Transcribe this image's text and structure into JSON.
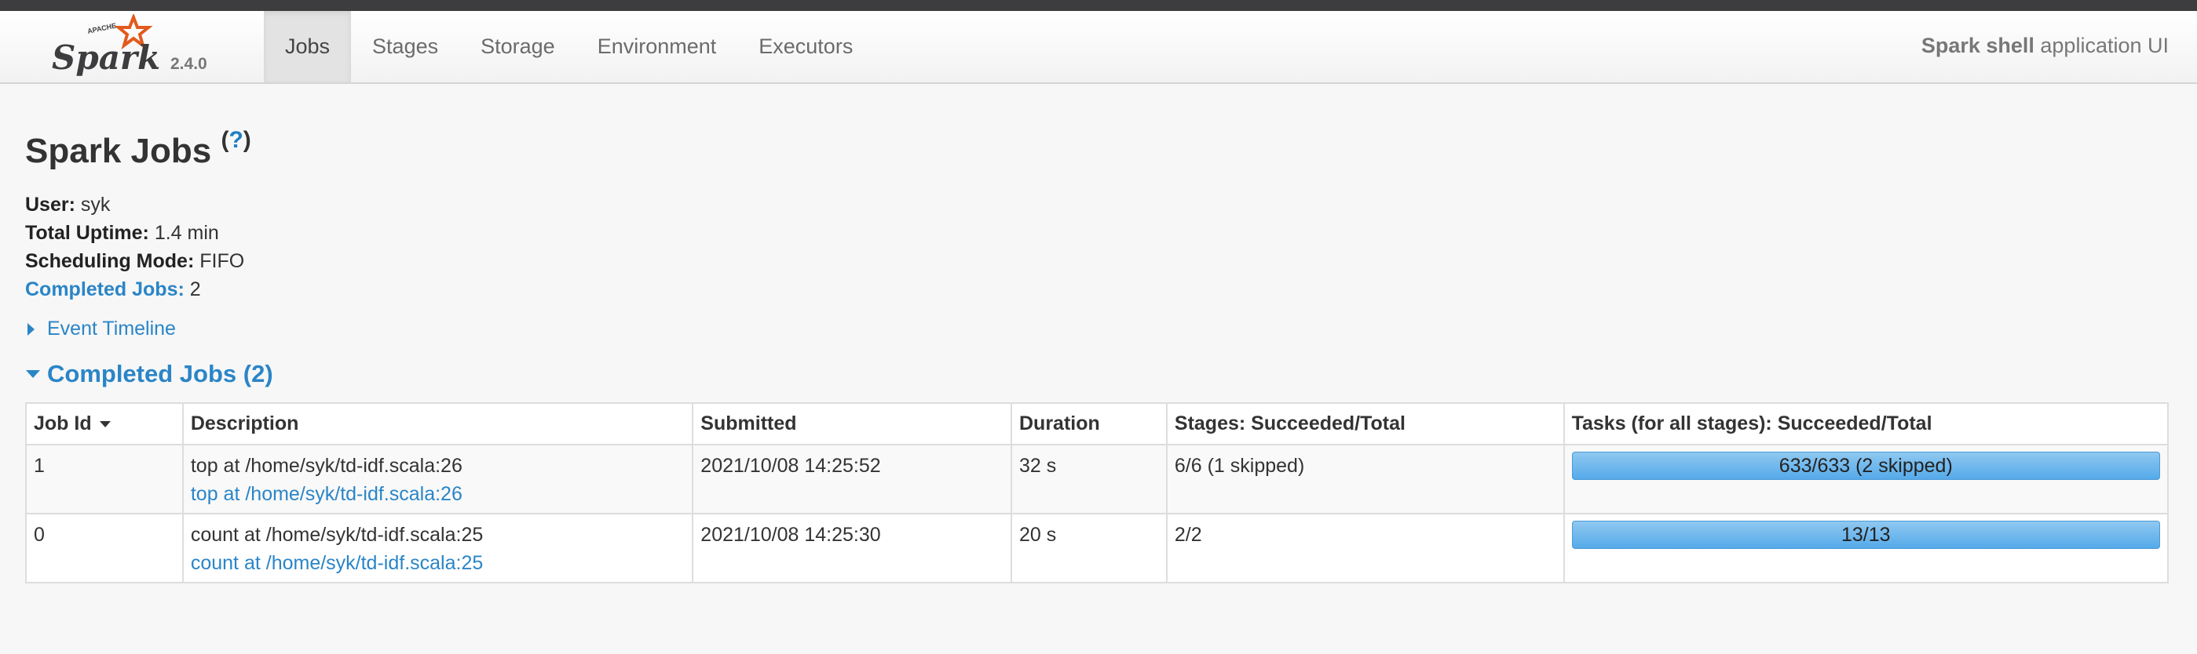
{
  "navbar": {
    "brand_small": "APACHE",
    "brand": "Spark",
    "version": "2.4.0",
    "tabs": [
      {
        "label": "Jobs",
        "active": true
      },
      {
        "label": "Stages",
        "active": false
      },
      {
        "label": "Storage",
        "active": false
      },
      {
        "label": "Environment",
        "active": false
      },
      {
        "label": "Executors",
        "active": false
      }
    ],
    "app_name": "Spark shell",
    "app_suffix": " application UI"
  },
  "page": {
    "title": "Spark Jobs ",
    "help_open": "(",
    "help_mark": "?",
    "help_close": ")"
  },
  "summary": {
    "user_label": "User:",
    "user": "syk",
    "uptime_label": "Total Uptime:",
    "uptime": "1.4 min",
    "mode_label": "Scheduling Mode:",
    "mode": "FIFO",
    "completed_label": "Completed Jobs:",
    "completed": "2"
  },
  "timeline": {
    "label": "Event Timeline"
  },
  "completed_section": {
    "label": "Completed Jobs (2)"
  },
  "table": {
    "headers": {
      "job_id": "Job Id",
      "description": "Description",
      "submitted": "Submitted",
      "duration": "Duration",
      "stages": "Stages: Succeeded/Total",
      "tasks": "Tasks (for all stages): Succeeded/Total"
    },
    "rows": [
      {
        "job_id": "1",
        "description": "top at /home/syk/td-idf.scala:26",
        "description_link": "top at /home/syk/td-idf.scala:26",
        "submitted": "2021/10/08 14:25:52",
        "duration": "32 s",
        "stages": "6/6 (1 skipped)",
        "tasks": "633/633 (2 skipped)",
        "tasks_progress": 1.0
      },
      {
        "job_id": "0",
        "description": "count at /home/syk/td-idf.scala:25",
        "description_link": "count at /home/syk/td-idf.scala:25",
        "submitted": "2021/10/08 14:25:30",
        "duration": "20 s",
        "stages": "2/2",
        "tasks": "13/13",
        "tasks_progress": 1.0
      }
    ]
  },
  "colors": {
    "link": "#2a85c7",
    "progress": "#55aaea",
    "logo_orange": "#e25a1c"
  }
}
